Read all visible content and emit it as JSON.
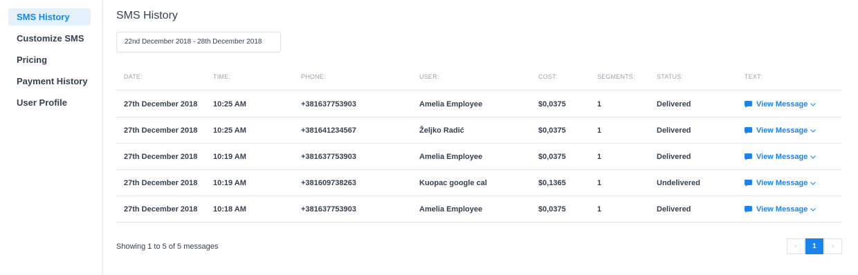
{
  "sidebar": {
    "items": [
      {
        "label": "SMS History",
        "active": true
      },
      {
        "label": "Customize SMS",
        "active": false
      },
      {
        "label": "Pricing",
        "active": false
      },
      {
        "label": "Payment History",
        "active": false
      },
      {
        "label": "User Profile",
        "active": false
      }
    ]
  },
  "main": {
    "title": "SMS History",
    "date_range": "22nd December 2018 - 28th December 2018"
  },
  "table": {
    "headers": {
      "date": "DATE:",
      "time": "TIME:",
      "phone": "PHONE:",
      "user": "USER:",
      "cost": "COST:",
      "segments": "SEGMENTS:",
      "status": "STATUS:",
      "text": "TEXT:"
    },
    "rows": [
      {
        "date": "27th December 2018",
        "time": "10:25 AM",
        "phone": "+381637753903",
        "user": "Amelia Employee",
        "cost": "$0,0375",
        "segments": "1",
        "status": "Delivered",
        "text": "View Message"
      },
      {
        "date": "27th December 2018",
        "time": "10:25 AM",
        "phone": "+381641234567",
        "user": "Željko Radić",
        "cost": "$0,0375",
        "segments": "1",
        "status": "Delivered",
        "text": "View Message"
      },
      {
        "date": "27th December 2018",
        "time": "10:19 AM",
        "phone": "+381637753903",
        "user": "Amelia Employee",
        "cost": "$0,0375",
        "segments": "1",
        "status": "Delivered",
        "text": "View Message"
      },
      {
        "date": "27th December 2018",
        "time": "10:19 AM",
        "phone": "+381609738263",
        "user": "Kuopac google cal",
        "cost": "$0,1365",
        "segments": "1",
        "status": "Undelivered",
        "text": "View Message"
      },
      {
        "date": "27th December 2018",
        "time": "10:18 AM",
        "phone": "+381637753903",
        "user": "Amelia Employee",
        "cost": "$0,0375",
        "segments": "1",
        "status": "Delivered",
        "text": "View Message"
      }
    ]
  },
  "footer": {
    "showing": "Showing 1 to 5 of 5 messages",
    "pagination": {
      "prev": "‹",
      "current": "1",
      "next": "›"
    }
  },
  "colors": {
    "accent": "#1a84ee",
    "active_bg": "#e4f1fd",
    "text": "#354052",
    "muted": "#9aa3ae"
  },
  "icons": {
    "message": "chat-bubble-icon",
    "expand": "chevron-down-icon"
  }
}
